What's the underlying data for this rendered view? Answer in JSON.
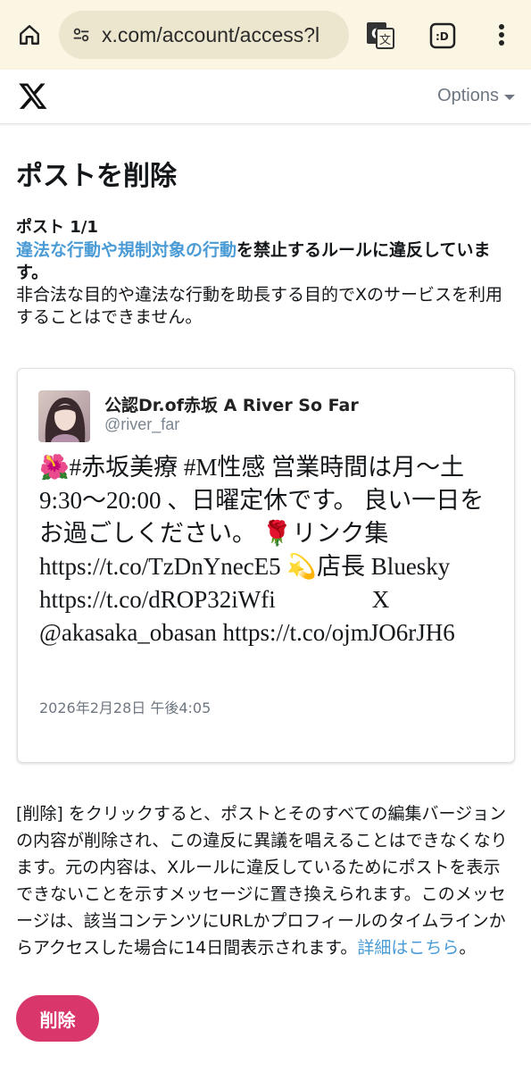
{
  "browser": {
    "url": "x.com/account/access?l",
    "icons": {
      "home": "home-icon",
      "site_settings": "tune-icon",
      "translate": "translate-icon",
      "tabs": "tab-switcher-icon",
      "menu": "more-vert-icon"
    },
    "tab_label": ":D"
  },
  "header": {
    "logo": "x-logo-icon",
    "options_label": "Options"
  },
  "main": {
    "title": "ポストを削除",
    "post_count": "ポスト 1/1",
    "violation_link": "違法な行動や規制対象の行動",
    "violation_rest": "を禁止するルールに違反しています。",
    "violation_desc": "非合法な目的や違法な行動を助長する目的でXのサービスを利用することはできません。"
  },
  "tweet": {
    "display_name": "公認Dr.of赤坂 A River So Far",
    "handle": "@river_far",
    "text": "🌺#赤坂美療 #M性感 営業時間は月〜土 9:30〜20:00 、日曜定休です。 良い一日をお過ごしください。 🌹リンク集 https://t.co/TzDnYnecE5 💫店長 Bluesky https://t.co/dROP32iWfi                X @akasaka_obasan https://t.co/ojmJO6rJH6",
    "date": "2026年2月28日 午後4:05"
  },
  "footer": {
    "note": "[削除] をクリックすると、ポストとそのすべての編集バージョンの内容が削除され、この違反に異議を唱えることはできなくなります。元の内容は、Xルールに違反しているためにポストを表示できないことを示すメッセージに置き換えられます。このメッセージは、該当コンテンツにURLかプロフィールのタイムラインからアクセスした場合に14日間表示されます。",
    "learn_more": "詳細はこちら",
    "end_mark": "。"
  },
  "actions": {
    "delete_label": "削除"
  },
  "colors": {
    "link": "#4a9bd6",
    "delete_button": "#d9366b",
    "browser_chrome": "#fbf6e4"
  }
}
